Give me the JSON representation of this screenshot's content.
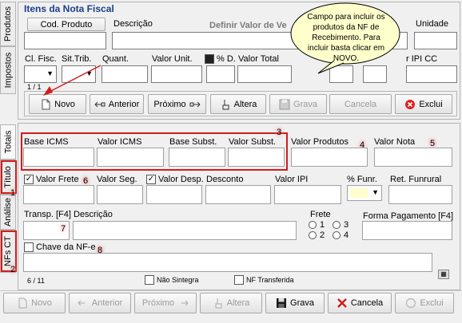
{
  "top_section": {
    "title": "Itens da Nota Fiscal",
    "cod_produto_label": "Cod. Produto",
    "descricao_label": "Descrição",
    "definir_valor_label": "Definir Valor de Ve",
    "unidade_label": "Unidade",
    "cl_fisc_label": "Cl. Fisc.",
    "sit_trib_label": "Sit.Trib.",
    "quant_label": "Quant.",
    "valor_unit_label": "Valor Unit.",
    "pct_d_label": "% D.",
    "valor_total_label": "Valor Total",
    "valor_ipi_cc_label": "r IPI CC",
    "record_counter": "1 / 1"
  },
  "tooltip": {
    "text": "Campo para incluir os produtos da NF de Recebimento. Para incluir basta clicar em NOVO."
  },
  "item_toolbar": {
    "novo": "Novo",
    "anterior": "Anterior",
    "proximo": "Próximo",
    "altera": "Altera",
    "grava": "Grava",
    "cancela": "Cancela",
    "exclui": "Exclui"
  },
  "left_tabs": {
    "produtos": "Produtos",
    "impostos": "Impostos",
    "totais": "Totais",
    "titulo": "Título",
    "analise": "Análise",
    "nfs_ct": "NFs CT"
  },
  "totals_section": {
    "base_icms_label": "Base ICMS",
    "valor_icms_label": "Valor ICMS",
    "base_subst_label": "Base Subst.",
    "valor_subst_label": "Valor Subst.",
    "valor_produtos_label": "Valor Produtos",
    "valor_nota_label": "Valor Nota",
    "valor_frete_label": "Valor Frete",
    "valor_seg_label": "Valor Seg.",
    "valor_desp_label": "Valor Desp.",
    "desconto_label": "Desconto",
    "valor_ipi_label": "Valor IPI",
    "pct_funr_label": "% Funr.",
    "ret_funrural_label": "Ret. Funrural",
    "transp_label": "Transp. [F4]",
    "descricao_label": "Descrição",
    "frete_label": "Frete",
    "frete_options": [
      "1",
      "2",
      "3",
      "4"
    ],
    "forma_pagamento_label": "Forma Pagamento [F4]",
    "chave_nfe_label": "Chave da NF-e",
    "record_counter": "6 / 11",
    "nao_sintegra_label": "Não Sintegra",
    "nf_transferida_label": "NF Transferida",
    "valor_frete_checked": true,
    "valor_desp_checked": true
  },
  "annotations": [
    "1",
    "2",
    "3",
    "4",
    "5",
    "6",
    "7",
    "8"
  ],
  "main_toolbar": {
    "novo": "Novo",
    "anterior": "Anterior",
    "proximo": "Próximo",
    "altera": "Altera",
    "grava": "Grava",
    "cancela": "Cancela",
    "exclui": "Exclui"
  },
  "colors": {
    "title_blue": "#1c3f8c",
    "annotation_red": "#d21c1c",
    "tooltip_fill": "#ffffcc"
  }
}
